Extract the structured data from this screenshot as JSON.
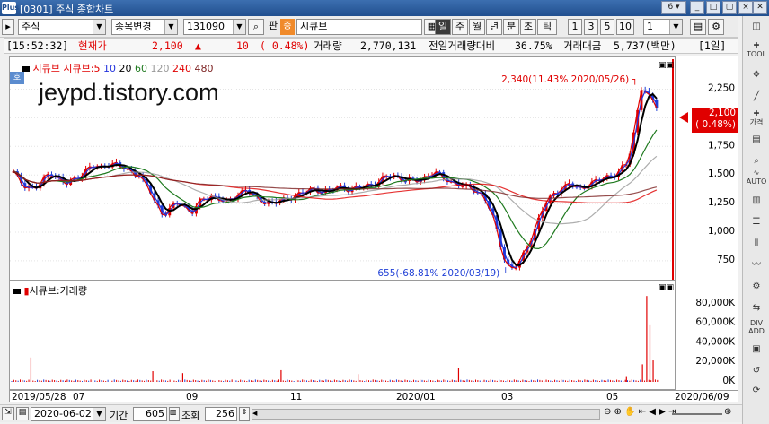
{
  "window": {
    "title": "[0301] 주식 종합차트",
    "logo": "Plus",
    "page_num": "6",
    "buttons": [
      "▾",
      "_",
      "□",
      "×"
    ]
  },
  "toolbar": {
    "market": "주식",
    "change_label": "종목변경",
    "code": "131090",
    "pan_label": "판",
    "stock_badge": "증",
    "stock_name": "시큐브",
    "periods": [
      "일",
      "주",
      "월",
      "년",
      "분",
      "초",
      "틱"
    ],
    "selected_period": "일",
    "intervals": [
      "1",
      "3",
      "5",
      "10"
    ],
    "interval_value": "1"
  },
  "info": {
    "time": "[15:52:32]",
    "label": "현재가",
    "price": "2,100",
    "arrow": "▲",
    "change": "10",
    "change_pct": "( 0.48%)",
    "volume_label": "거래량",
    "volume": "2,770,131",
    "prev_ratio_label": "전일거래량대비",
    "prev_ratio": "36.75%",
    "amount_label": "거래대금",
    "amount": "5,737(백만)",
    "period_tag": "[1일]"
  },
  "price_panel": {
    "watermark": "jeypd.tistory.com",
    "badge": "호",
    "legend": [
      {
        "text": "시큐브",
        "color": "#e00000"
      },
      {
        "text": "시큐브:5",
        "color": "#e00000"
      },
      {
        "text": "10",
        "color": "#2233dd"
      },
      {
        "text": "20",
        "color": "#000000"
      },
      {
        "text": "60",
        "color": "#1f7a1f"
      },
      {
        "text": "120",
        "color": "#999999"
      },
      {
        "text": "240",
        "color": "#e00000"
      },
      {
        "text": "480",
        "color": "#7b1f1f"
      }
    ],
    "high_label": "2,340(11.43% 2020/05/26)",
    "low_label": "655(-68.81% 2020/03/19)",
    "current_price": "2,100",
    "current_pct": "( 0.48%)"
  },
  "volume_panel": {
    "legend": "시큐브:거래량"
  },
  "bottom": {
    "date": "2020-06-02",
    "period_label": "기간",
    "period_value": "605",
    "view_label": "조회",
    "view_value": "256"
  },
  "chart_data": [
    {
      "type": "candlestick",
      "title": "시큐브",
      "x_ticks": [
        "2019/05/28",
        "07",
        "09",
        "11",
        "2020/01",
        "03",
        "05",
        "2020/06/09"
      ],
      "y_ticks": [
        750,
        1000,
        1250,
        1500,
        1750,
        2000,
        2250
      ],
      "ylim": [
        600,
        2450
      ],
      "close": [
        1520,
        1460,
        1420,
        1400,
        1380,
        1390,
        1450,
        1500,
        1520,
        1480,
        1440,
        1420,
        1450,
        1470,
        1510,
        1540,
        1560,
        1580,
        1560,
        1590,
        1600,
        1590,
        1570,
        1560,
        1540,
        1520,
        1500,
        1420,
        1380,
        1290,
        1220,
        1150,
        1180,
        1230,
        1260,
        1240,
        1200,
        1180,
        1230,
        1280,
        1300,
        1320,
        1300,
        1280,
        1260,
        1280,
        1330,
        1350,
        1370,
        1340,
        1300,
        1280,
        1270,
        1260,
        1250,
        1270,
        1280,
        1300,
        1320,
        1330,
        1340,
        1360,
        1380,
        1370,
        1360,
        1350,
        1370,
        1390,
        1400,
        1380,
        1370,
        1380,
        1390,
        1410,
        1420,
        1430,
        1450,
        1480,
        1490,
        1500,
        1470,
        1460,
        1450,
        1440,
        1460,
        1480,
        1500,
        1520,
        1500,
        1470,
        1460,
        1430,
        1420,
        1400,
        1390,
        1380,
        1360,
        1320,
        1250,
        1150,
        1000,
        850,
        720,
        680,
        700,
        760,
        850,
        950,
        1050,
        1150,
        1250,
        1300,
        1350,
        1380,
        1390,
        1420,
        1400,
        1380,
        1400,
        1420,
        1430,
        1450,
        1470,
        1490,
        1500,
        1520,
        1560,
        1600,
        1800,
        2050,
        2300,
        2200,
        2150,
        2100
      ],
      "ma": [
        {
          "name": "5",
          "color": "#e00000"
        },
        {
          "name": "10",
          "color": "#2233dd"
        },
        {
          "name": "20",
          "color": "#000000"
        },
        {
          "name": "60",
          "color": "#1f7a1f"
        },
        {
          "name": "120",
          "color": "#999999"
        },
        {
          "name": "240",
          "color": "#e00000"
        },
        {
          "name": "480",
          "color": "#7b1f1f"
        }
      ]
    },
    {
      "type": "bar",
      "title": "시큐브:거래량",
      "y_ticks": [
        "0K",
        "20,000K",
        "40,000K",
        "60,000K",
        "80,000K"
      ],
      "ylim": [
        0,
        90000
      ],
      "spikes": [
        {
          "index": 18,
          "value": 25000
        },
        {
          "index": 132,
          "value": 11000
        },
        {
          "index": 160,
          "value": 9000
        },
        {
          "index": 252,
          "value": 12000
        },
        {
          "index": 324,
          "value": 8000
        },
        {
          "index": 418,
          "value": 14000
        },
        {
          "index": 575,
          "value": 5000
        },
        {
          "index": 590,
          "value": 18000
        },
        {
          "index": 594,
          "value": 88000
        },
        {
          "index": 597,
          "value": 58000
        },
        {
          "index": 600,
          "value": 22000
        }
      ],
      "base": 1500
    }
  ]
}
